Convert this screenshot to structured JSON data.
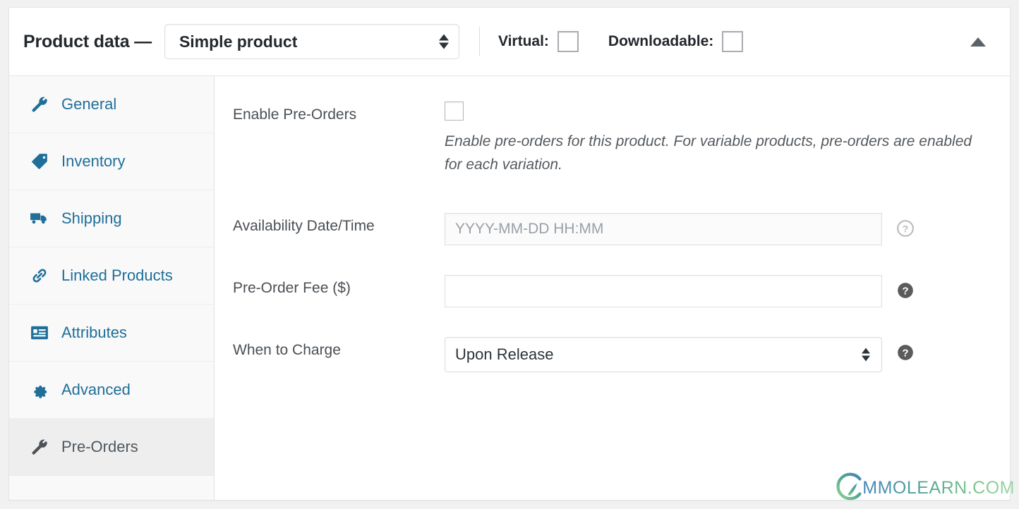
{
  "header": {
    "title": "Product data —",
    "product_type": {
      "value": "Simple product",
      "icon": "updown-spinner-icon"
    },
    "virtual": {
      "label": "Virtual:",
      "checked": false
    },
    "downloadable": {
      "label": "Downloadable:",
      "checked": false
    },
    "collapse": {
      "icon": "caret-up-icon"
    }
  },
  "tabs": [
    {
      "label": "General",
      "icon": "wrench-icon",
      "active": false
    },
    {
      "label": "Inventory",
      "icon": "tag-icon",
      "active": false
    },
    {
      "label": "Shipping",
      "icon": "truck-icon",
      "active": false
    },
    {
      "label": "Linked Products",
      "icon": "link-icon",
      "active": false
    },
    {
      "label": "Attributes",
      "icon": "list-card-icon",
      "active": false
    },
    {
      "label": "Advanced",
      "icon": "gear-icon",
      "active": false
    },
    {
      "label": "Pre-Orders",
      "icon": "wrench-icon",
      "active": true
    }
  ],
  "form": {
    "enable_preorders": {
      "label": "Enable Pre-Orders",
      "checked": false,
      "description": "Enable pre-orders for this product. For variable products, pre-orders are enabled for each variation."
    },
    "availability": {
      "label": "Availability Date/Time",
      "value": "",
      "placeholder": "YYYY-MM-DD HH:MM",
      "help_icon": "help-circle-outline-icon"
    },
    "fee": {
      "label": "Pre-Order Fee ($)",
      "value": "",
      "placeholder": "",
      "help_icon": "help-circle-filled-icon"
    },
    "when_to_charge": {
      "label": "When to Charge",
      "value": "Upon Release",
      "help_icon": "help-circle-filled-icon"
    }
  },
  "watermark": {
    "text": "MMOLEARN.COM",
    "icon": "mmolearn-logo-icon"
  },
  "colors": {
    "link_blue": "#1f6f99",
    "active_tab_bg": "#eeeeee",
    "sidebar_bg": "#f9f9f9",
    "text_dark": "#23282d",
    "help_dark": "#5b5b5b"
  }
}
